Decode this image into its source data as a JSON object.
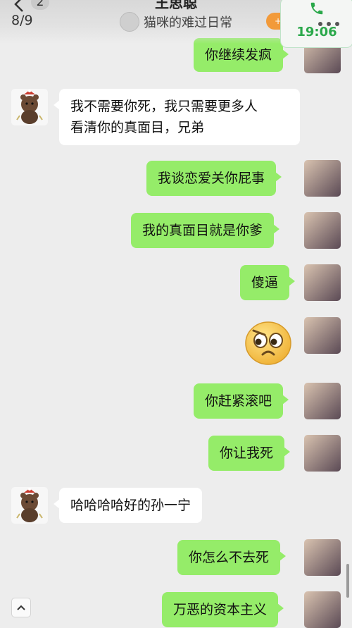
{
  "header": {
    "back_count": "2",
    "page_counter": "8/9",
    "title": "王思聪",
    "subtitle": "猫咪的难过日常",
    "follow_label": "+关注",
    "call_time": "19:06"
  },
  "messages": [
    {
      "sender": "me",
      "text": "你继续发疯"
    },
    {
      "sender": "them",
      "lines": [
        "我不需要你死，我只需要更多人",
        "看清你的真面目，兄弟"
      ]
    },
    {
      "sender": "me",
      "text": "我谈恋爱关你屁事"
    },
    {
      "sender": "me",
      "text": "我的真面目就是你爹"
    },
    {
      "sender": "me",
      "text": "傻逼"
    },
    {
      "sender": "me",
      "sticker": "worried-face-emoji"
    },
    {
      "sender": "me",
      "text": "你赶紧滚吧"
    },
    {
      "sender": "me",
      "text": "你让我死"
    },
    {
      "sender": "them",
      "text": "哈哈哈哈好的孙一宁"
    },
    {
      "sender": "me",
      "text": "你怎么不去死"
    },
    {
      "sender": "me",
      "text": "万恶的资本主义"
    }
  ],
  "colors": {
    "my_bubble": "#95ec69",
    "their_bubble": "#ffffff",
    "background": "#ededed",
    "follow_button": "#f29a3a",
    "call_green": "#2aa84a"
  },
  "icons": [
    "back-chevron-icon",
    "phone-icon",
    "more-icon",
    "scroll-up-icon"
  ]
}
